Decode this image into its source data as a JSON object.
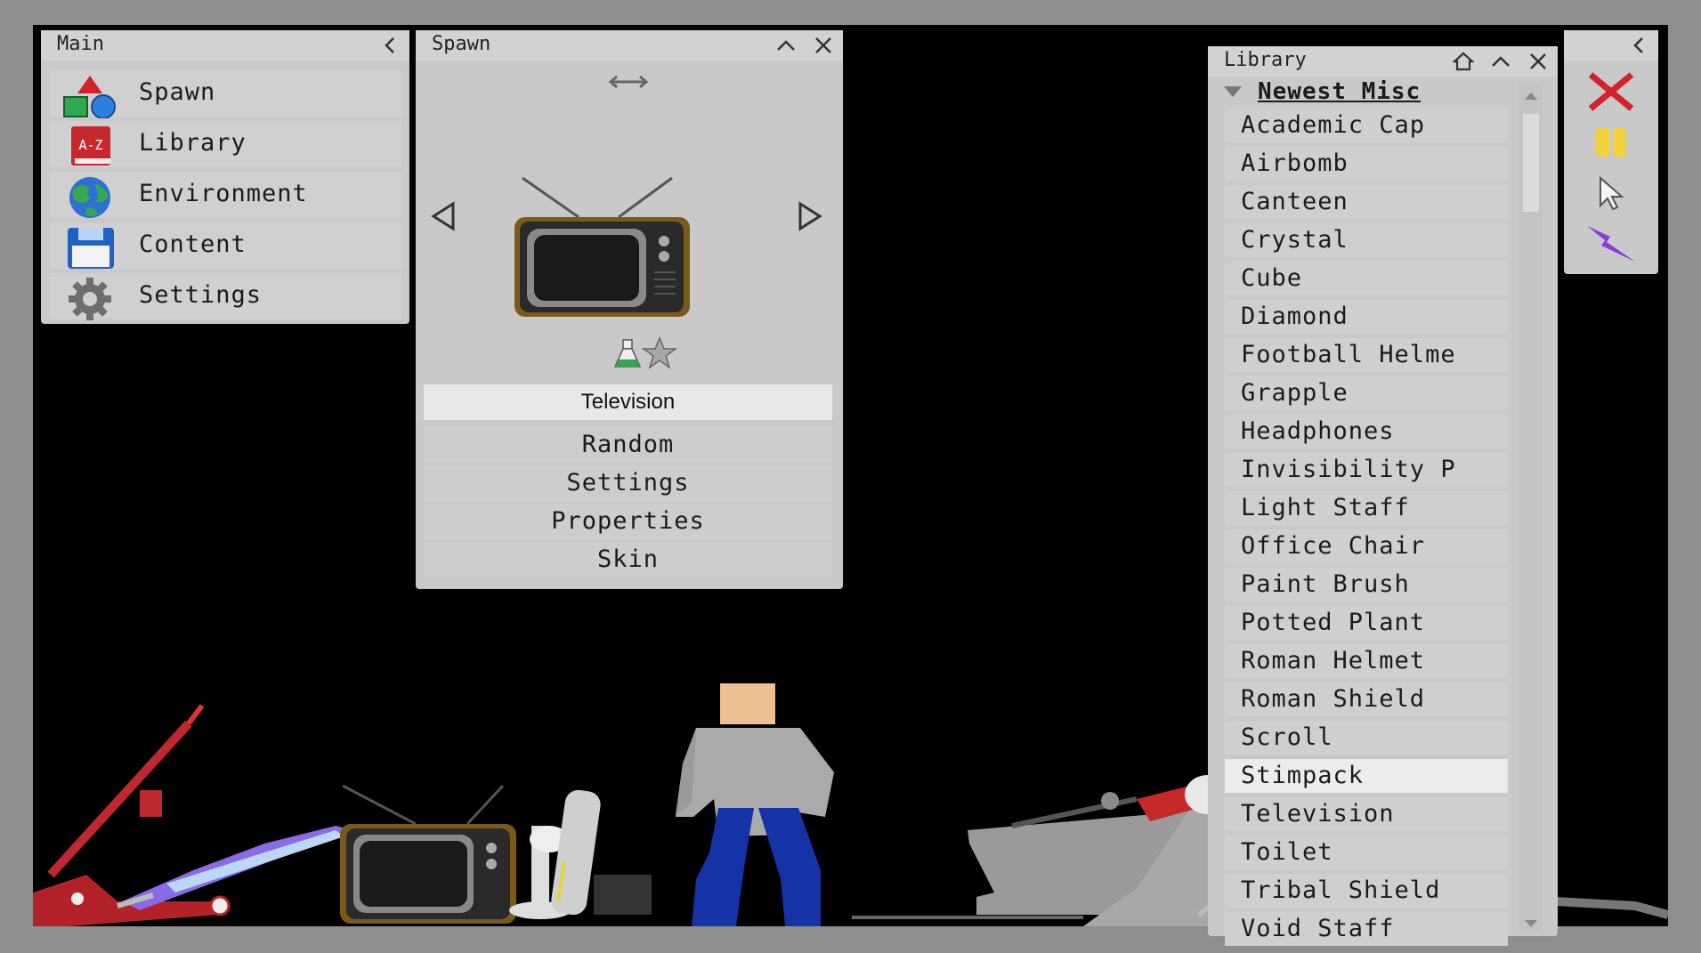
{
  "main_panel": {
    "title": "Main",
    "items": [
      {
        "label": "Spawn",
        "icon": "shapes-icon"
      },
      {
        "label": "Library",
        "icon": "library-az-icon"
      },
      {
        "label": "Environment",
        "icon": "globe-icon"
      },
      {
        "label": "Content",
        "icon": "floppy-disk-icon"
      },
      {
        "label": "Settings",
        "icon": "gear-icon"
      }
    ]
  },
  "spawn_panel": {
    "title": "Spawn",
    "selected_item": "Television",
    "buttons": [
      "Random",
      "Settings",
      "Properties",
      "Skin"
    ]
  },
  "library_panel": {
    "title": "Library",
    "category": "Newest Misc",
    "items": [
      "Academic Cap",
      "Airbomb",
      "Canteen",
      "Crystal",
      "Cube",
      "Diamond",
      "Football Helme",
      "Grapple",
      "Headphones",
      "Invisibility P",
      "Light Staff",
      "Office Chair",
      "Paint Brush",
      "Potted Plant",
      "Roman Helmet",
      "Roman Shield",
      "Scroll",
      "Stimpack",
      "Television",
      "Toilet",
      "Tribal Shield",
      "Void Staff"
    ],
    "selected": "Stimpack"
  },
  "tools": [
    "close-x-icon",
    "pause-icon",
    "cursor-icon",
    "lightning-icon"
  ],
  "colors": {
    "accent_red": "#d2232a",
    "pause_yellow": "#f2d23b",
    "lightning_purple": "#8a3bdc",
    "panel_bg": "#c9c9c9",
    "selected_bg": "#ececec"
  }
}
